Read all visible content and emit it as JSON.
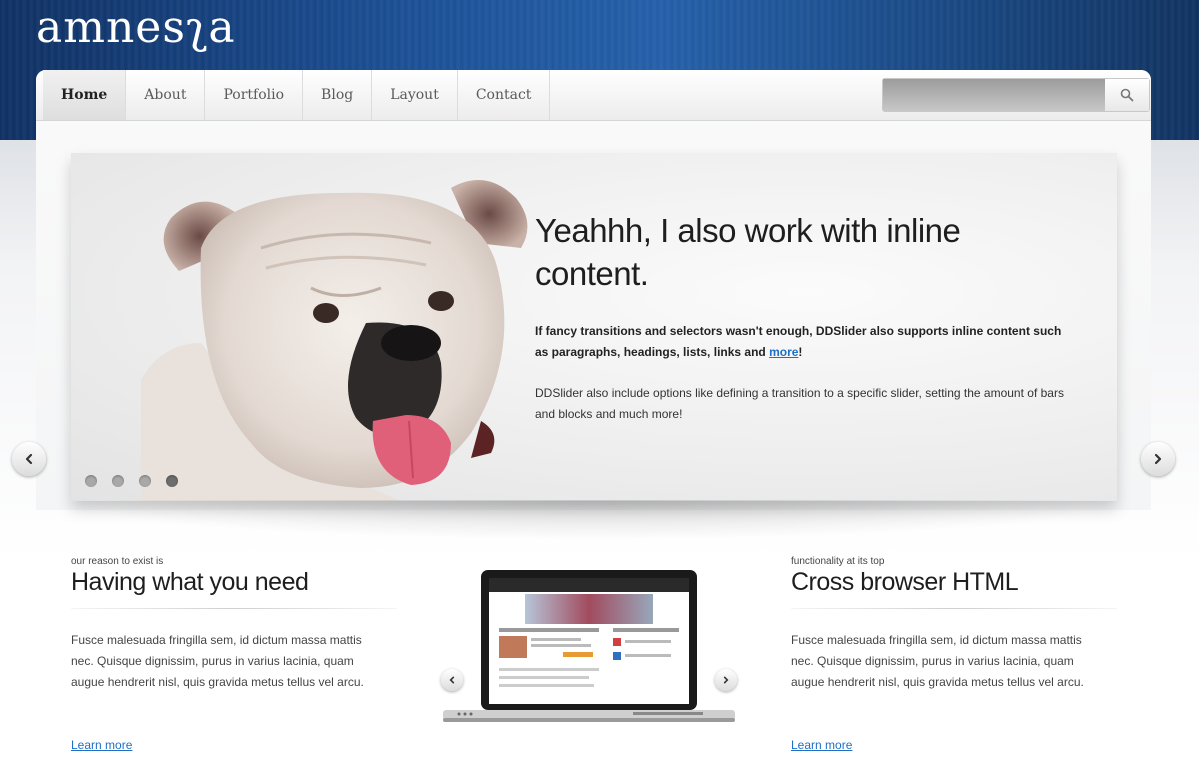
{
  "brand": {
    "logo_text": "amnesʅa"
  },
  "nav": {
    "items": [
      {
        "label": "Home",
        "active": true
      },
      {
        "label": "About"
      },
      {
        "label": "Portfolio"
      },
      {
        "label": "Blog"
      },
      {
        "label": "Layout"
      },
      {
        "label": "Contact"
      }
    ],
    "search": {
      "value": "",
      "placeholder": ""
    }
  },
  "slider": {
    "title": "Yeahhh, I also work with inline content.",
    "para1_text": "If fancy transitions and selectors wasn't enough, DDSlider also supports inline content such as paragraphs, headings, lists, links and ",
    "para1_link": "more",
    "para1_end": "!",
    "para2": "DDSlider also include options like defining a transition to a specific slider, setting the amount of bars and blocks and much more!",
    "dots_count": 4,
    "active_dot": 3
  },
  "features": [
    {
      "eyebrow": "our reason to exist is",
      "title": "Having what you need",
      "body": "Fusce malesuada fringilla sem, id dictum massa mattis nec. Quisque dignissim, purus in varius lacinia, quam augue hendrerit nisl, quis gravida metus tellus vel arcu.",
      "link": "Learn more"
    },
    {
      "eyebrow": "functionality at its top",
      "title": "Cross browser HTML",
      "body": "Fusce malesuada fringilla sem, id dictum massa mattis nec. Quisque dignissim, purus in varius lacinia, quam augue hendrerit nisl, quis gravida metus tellus vel arcu.",
      "link": "Learn more"
    }
  ],
  "colors": {
    "header_blue": "#1a4f95",
    "link_blue": "#1f6fc5",
    "dog_tongue": "#e0607a"
  },
  "icons": [
    "search-icon",
    "arrow-left-icon",
    "arrow-right-icon",
    "laptop-icon"
  ]
}
